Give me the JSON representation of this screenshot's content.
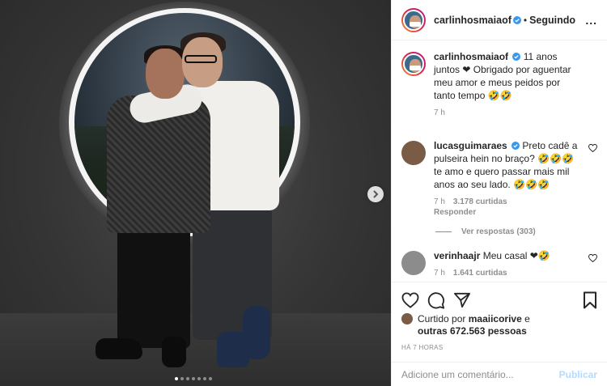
{
  "post": {
    "author": "carlinhosmaiaof",
    "follow_status": "Seguindo",
    "separator": "•",
    "more_label": "...",
    "image": {
      "current_slide": 1,
      "total_slides": 7
    }
  },
  "caption": {
    "username": "carlinhosmaiaof",
    "text": "11 anos juntos ❤ Obrigado por aguentar meu amor e meus peidos por tanto tempo 🤣🤣",
    "time": "7 h"
  },
  "comments": [
    {
      "username": "lucasguimaraes",
      "verified": true,
      "text": "Preto cadê a pulseira hein no braço? 🤣🤣🤣 te amo e quero passar mais mil anos ao seu lado. 🤣🤣🤣",
      "time": "7 h",
      "likes": "3.178 curtidas",
      "reply": "Responder",
      "view_replies": "Ver respostas (303)"
    },
    {
      "username": "verinhaajr",
      "verified": false,
      "text": "Meu casal ❤🤣",
      "time": "7 h",
      "likes": "1.641 curtidas"
    }
  ],
  "likes": {
    "prefix": "Curtido por",
    "user": "maaiicorive",
    "connector": "e",
    "others": "outras 672.563 pessoas"
  },
  "timestamp": "HÁ 7 HORAS",
  "add_comment": {
    "placeholder": "Adicione um comentário...",
    "publish_label": "Publicar"
  },
  "colors": {
    "verified": "#3897f0",
    "publish_disabled": "#b3dbff",
    "muted": "#8e8e8e",
    "text": "#262626"
  },
  "icons": [
    "verified-icon",
    "heart-icon",
    "comment-icon",
    "share-icon",
    "bookmark-icon",
    "next-icon",
    "more-icon"
  ]
}
